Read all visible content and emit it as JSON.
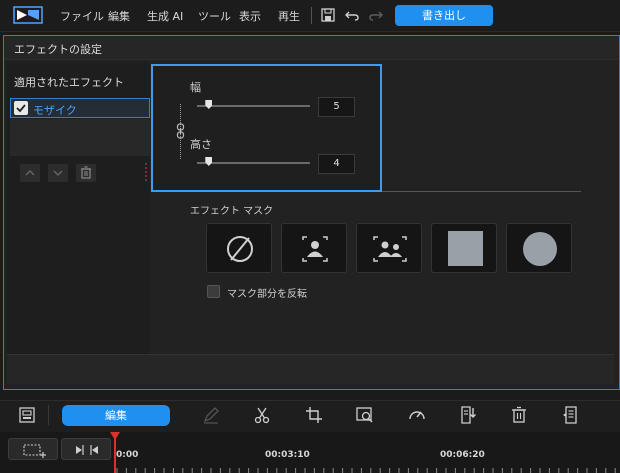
{
  "menubar": {
    "items": [
      "ファイル",
      "編集",
      "生成 AI",
      "ツール",
      "表示",
      "再生"
    ],
    "export_label": "書き出し",
    "icons": [
      "logo-icon",
      "save-icon",
      "undo-icon",
      "redo-icon"
    ]
  },
  "dialog": {
    "title": "エフェクトの設定",
    "applied_heading": "適用されたエフェクト",
    "effects": [
      {
        "label": "モザイク",
        "checked": true
      }
    ],
    "settings": {
      "width_label": "幅",
      "width_value": "5",
      "width_level": 0.1,
      "height_label": "高さ",
      "height_value": "4",
      "height_level": 0.1,
      "linked": true
    },
    "mask": {
      "heading": "エフェクト マスク",
      "options": [
        "none-mask-icon",
        "person-mask-icon",
        "people-mask-icon",
        "square-mask-icon",
        "circle-mask-icon"
      ],
      "invert_label": "マスク部分を反転",
      "invert_checked": false
    }
  },
  "toolbar": {
    "edit_label": "編集",
    "icons": [
      "select-icon",
      "pen-icon",
      "cut-icon",
      "crop-icon",
      "preview-icon",
      "speed-icon",
      "import-icon",
      "delete-icon",
      "report-icon"
    ]
  },
  "timeline": {
    "times": [
      "0:00",
      "00:03:10",
      "00:06:20"
    ]
  },
  "colors": {
    "accent": "#1f8ff0",
    "highlight_border": "#3d9bf0",
    "playhead": "#d9312b"
  }
}
